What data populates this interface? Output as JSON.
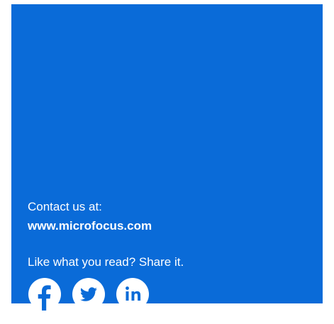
{
  "panel": {
    "background_color": "#0a6bd8",
    "contact_label": "Contact us at:",
    "contact_url": "www.microfocus.com",
    "share_prompt": "Like what you read? Share it."
  },
  "social": [
    {
      "icon": "facebook-icon"
    },
    {
      "icon": "twitter-icon"
    },
    {
      "icon": "linkedin-icon"
    }
  ]
}
